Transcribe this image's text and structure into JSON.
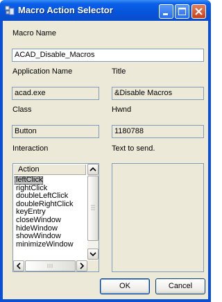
{
  "window": {
    "title": "Macro Action Selector"
  },
  "labels": {
    "macro_name": "Macro Name",
    "application_name": "Application Name",
    "title": "Title",
    "class": "Class",
    "hwnd": "Hwnd",
    "interaction": "Interaction",
    "text_to_send": "Text to send."
  },
  "fields": {
    "macro_name": "ACAD_Disable_Macros",
    "application_name": "acad.exe",
    "title": "&Disable Macros",
    "class": "Button",
    "hwnd": "1180788"
  },
  "action_list": {
    "header": "Action",
    "items": [
      "leftClick",
      "rightClick",
      "doubleLeftClick",
      "doubleRightClick",
      "keyEntry",
      "closeWindow",
      "hideWindow",
      "showWindow",
      "minimizeWindow"
    ],
    "selected": "leftClick"
  },
  "buttons": {
    "ok": "OK",
    "cancel": "Cancel"
  },
  "icons": {
    "app": "macro-app-icon",
    "minimize": "minimize-icon",
    "maximize": "maximize-icon",
    "close": "close-icon"
  }
}
